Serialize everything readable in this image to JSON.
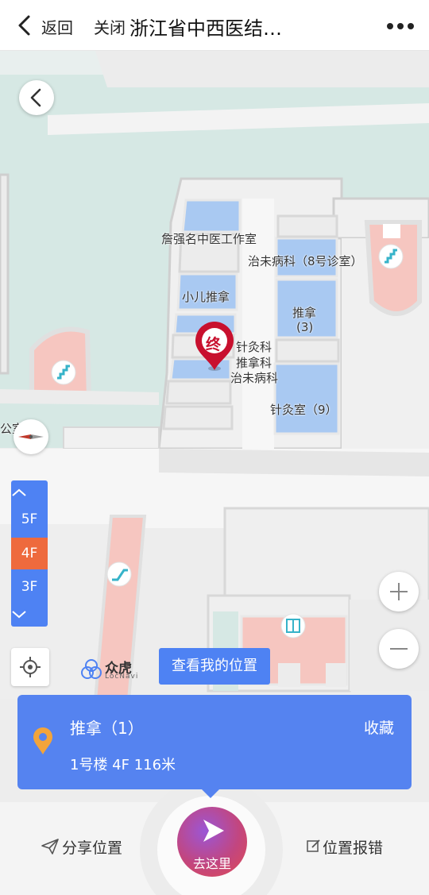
{
  "topbar": {
    "back_label": "返回",
    "close_label": "关闭",
    "title": "浙江省中西医结…",
    "back_icon": "chevron-left-icon",
    "more_icon": "more-dots-icon"
  },
  "map": {
    "labels": {
      "room1": "詹强名中医工作室",
      "room2": "治未病科（8号诊室）",
      "room3": "小儿推拿",
      "room4_line1": "推拿",
      "room4_line2": "(3)",
      "room5_line1": "针灸科",
      "room5_line2": "推拿科",
      "room5_line3": "治未病科",
      "room6": "针灸室（9）",
      "room7": "公室"
    },
    "destination_marker_text": "终",
    "floors": [
      "5F",
      "4F",
      "3F"
    ],
    "active_floor": "4F",
    "my_location_button": "查看我的位置",
    "brand_name": "众虎",
    "brand_sub": "LocNavi",
    "icons": {
      "stairs": "stairs-icon",
      "elevator": "elevator-icon",
      "escalator": "escalator-icon",
      "compass": "compass-icon",
      "zoom_in": "plus-icon",
      "zoom_out": "minus-icon",
      "locate": "locate-crosshair-icon"
    },
    "colors": {
      "room_blue": "#a9c9f2",
      "room_pink": "#f6c6c0",
      "green_area": "#d6e8e4",
      "accent": "#4e82f3",
      "active_floor": "#ee6a3d",
      "marker": "#c8102e"
    }
  },
  "card": {
    "name": "推拿（1）",
    "favorite_label": "收藏",
    "meta": "1号楼 4F 116米",
    "pin_icon": "location-pin-icon",
    "pin_color": "#f3a43b"
  },
  "bottom": {
    "share_label": "分享位置",
    "go_label": "去这里",
    "report_label": "位置报错"
  }
}
